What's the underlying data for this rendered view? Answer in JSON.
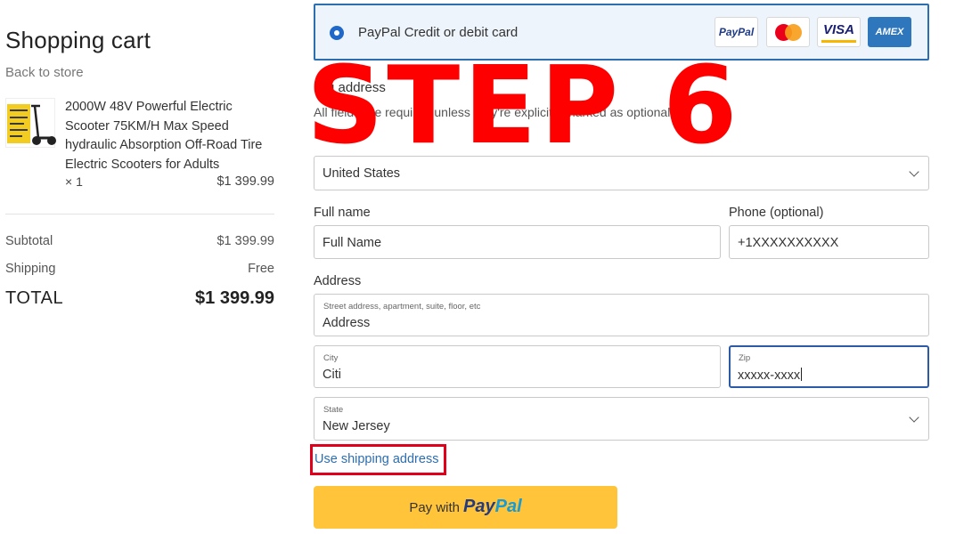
{
  "cart": {
    "title": "Shopping cart",
    "back_link": "Back to store",
    "item": {
      "name": "2000W 48V Powerful Electric Scooter 75KM/H Max Speed hydraulic Absorption Off-Road Tire Electric Scooters for Adults",
      "quantity": "× 1",
      "price": "$1 399.99"
    },
    "subtotal_label": "Subtotal",
    "subtotal_value": "$1 399.99",
    "shipping_label": "Shipping",
    "shipping_value": "Free",
    "total_label": "TOTAL",
    "total_value": "$1 399.99"
  },
  "payment": {
    "option_label": "PayPal Credit or debit card",
    "card_logos": [
      "PayPal",
      "Mastercard",
      "VISA",
      "AMEX"
    ],
    "selected": true
  },
  "billing": {
    "heading_visible": "ling address",
    "hint_visible": "All fields are required unless they're explicitly marked as optional."
  },
  "form": {
    "country_value": "United States",
    "full_name_label": "Full name",
    "full_name_placeholder": "Full Name",
    "phone_label": "Phone (optional)",
    "phone_value": "+1XXXXXXXXXX",
    "address_label": "Address",
    "street_label": "Street address, apartment, suite, floor, etc",
    "street_placeholder": "Address",
    "city_label": "City",
    "city_value": "Citi",
    "zip_label": "Zip",
    "zip_value": "xxxxx-xxxx",
    "state_label": "State",
    "state_value": "New Jersey"
  },
  "use_shipping_link": "Use shipping address",
  "pay_button": {
    "prefix": "Pay with",
    "brand_part1": "Pay",
    "brand_part2": "Pal"
  },
  "overlay": {
    "text": "STEP 6",
    "color": "#ff0000"
  },
  "colors": {
    "accent": "#2d6eb0",
    "paypal_yellow": "#ffc439",
    "highlight_red": "#e0001b"
  }
}
